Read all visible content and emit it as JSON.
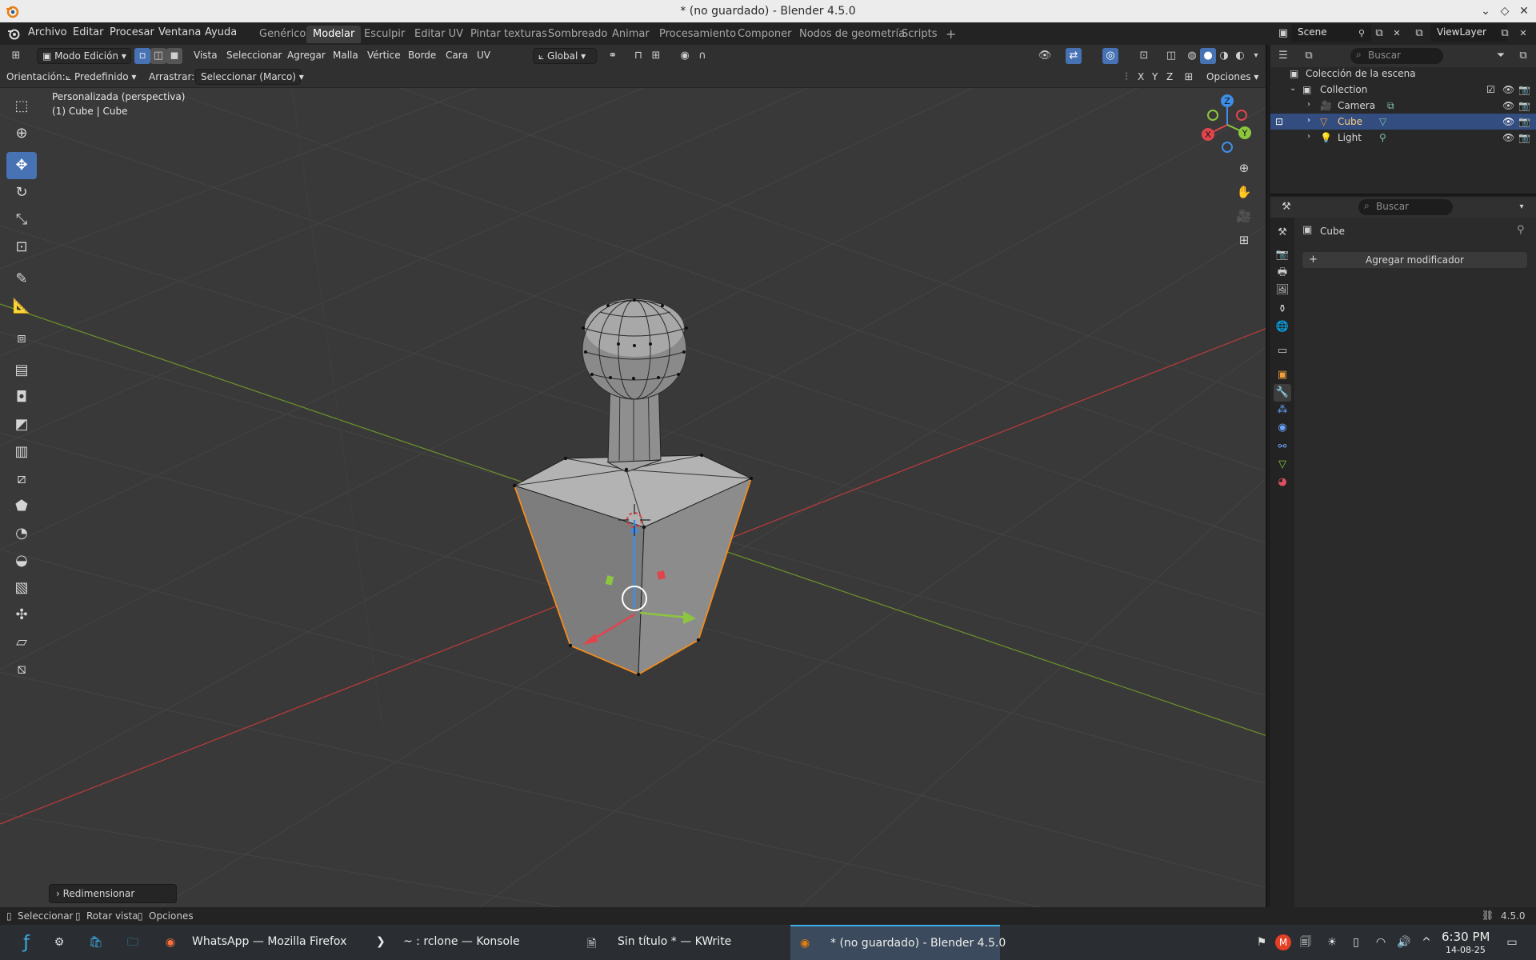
{
  "window": {
    "title": "* (no guardado) - Blender 4.5.0"
  },
  "menu": [
    "Archivo",
    "Editar",
    "Procesar",
    "Ventana",
    "Ayuda"
  ],
  "workspaces": [
    "Genérico",
    "Modelar",
    "Esculpir",
    "Editar UV",
    "Pintar texturas",
    "Sombreado",
    "Animar",
    "Procesamiento",
    "Componer",
    "Nodos de geometría",
    "Scripts"
  ],
  "active_workspace": "Modelar",
  "scene": {
    "name": "Scene",
    "view_layer": "ViewLayer"
  },
  "viewport_header": {
    "mode": "Modo Edición",
    "menus": [
      "Vista",
      "Seleccionar",
      "Agregar",
      "Malla",
      "Vértice",
      "Borde",
      "Cara",
      "UV"
    ],
    "transform_orientation": "Global"
  },
  "tool_settings": {
    "orientation_label": "Orientación:",
    "orientation_value": "Predefinido",
    "drag_label": "Arrastrar:",
    "drag_value": "Seleccionar (Marco)",
    "axes": [
      "X",
      "Y",
      "Z"
    ],
    "options": "Opciones"
  },
  "viewport_info": {
    "view": "Personalizada (perspectiva)",
    "object": "(1) Cube | Cube"
  },
  "gizmo_axes": {
    "x": "X",
    "y": "Y",
    "z": "Z"
  },
  "last_operator": "Redimensionar",
  "outliner": {
    "search_placeholder": "Buscar",
    "root": "Colección de la escena",
    "collection": "Collection",
    "items": [
      {
        "name": "Camera",
        "selected": false
      },
      {
        "name": "Cube",
        "selected": true
      },
      {
        "name": "Light",
        "selected": false
      }
    ]
  },
  "properties": {
    "search_placeholder": "Buscar",
    "object_name": "Cube",
    "add_modifier": "Agregar modificador",
    "active_tab": "modifier-wrench-icon"
  },
  "statusbar": {
    "select": "Seleccionar",
    "rotate": "Rotar vista",
    "options": "Opciones",
    "version": "4.5.0"
  },
  "taskbar": {
    "tasks": [
      {
        "label": "WhatsApp — Mozilla Firefox",
        "active": false
      },
      {
        "label": "~ : rclone — Konsole",
        "active": false
      },
      {
        "label": "Sin título * — KWrite",
        "active": false
      },
      {
        "label": "* (no guardado) - Blender 4.5.0",
        "active": true
      }
    ],
    "time": "6:30 PM",
    "date": "14-08-25"
  },
  "colors": {
    "accent": "#4772b3",
    "selection": "#334d80",
    "x_axis": "#e0454e",
    "y_axis": "#8cc63f",
    "z_axis": "#3e8ee8",
    "edit_outline": "#f28c1e"
  }
}
